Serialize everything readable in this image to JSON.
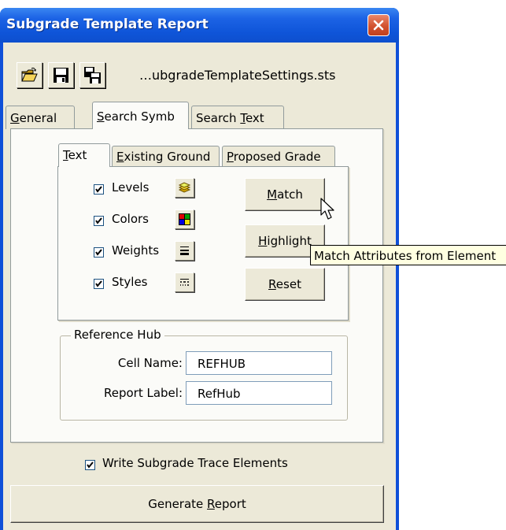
{
  "window": {
    "title": "Subgrade Template Report"
  },
  "toolbar": {
    "open_icon": "folder-open-icon",
    "save_icon": "floppy-disk-icon",
    "save_as_icon": "save-as-icon",
    "filename": "…ubgradeTemplateSettings.sts"
  },
  "main_tabs": [
    {
      "pre": "",
      "key": "G",
      "post": "eneral"
    },
    {
      "pre": "",
      "key": "S",
      "post": "earch Symb"
    },
    {
      "pre": "Search ",
      "key": "T",
      "post": "ext"
    }
  ],
  "inner_tabs": [
    {
      "pre": "",
      "key": "T",
      "post": "ext"
    },
    {
      "pre": "",
      "key": "E",
      "post": "xisting Ground"
    },
    {
      "pre": "",
      "key": "P",
      "post": "roposed Grade"
    }
  ],
  "attributes": [
    {
      "label": "Levels",
      "checked": true,
      "icon": "levels-icon"
    },
    {
      "label": "Colors",
      "checked": true,
      "icon": "colors-icon"
    },
    {
      "label": "Weights",
      "checked": true,
      "icon": "weights-icon"
    },
    {
      "label": "Styles",
      "checked": true,
      "icon": "styles-icon"
    }
  ],
  "buttons": {
    "match": {
      "key": "M",
      "post": "atch"
    },
    "highlight": {
      "key": "H",
      "post": "ighlight"
    },
    "reset": {
      "key": "R",
      "post": "eset"
    }
  },
  "tooltip": "Match Attributes from Element",
  "reference_hub": {
    "legend": "Reference Hub",
    "cell_name_label": "Cell Name:",
    "cell_name_value": "REFHUB",
    "report_label_label": "Report Label:",
    "report_label_value": "RefHub"
  },
  "write_trace": {
    "label": "Write Subgrade Trace Elements",
    "checked": true
  },
  "generate": {
    "pre": "Generate ",
    "key": "R",
    "post": "eport"
  },
  "colors": {
    "title_blue": "#0f55d9",
    "dialog_bg": "#ece9d8",
    "close_red": "#d2522f",
    "tooltip_bg": "#ffffe1"
  }
}
